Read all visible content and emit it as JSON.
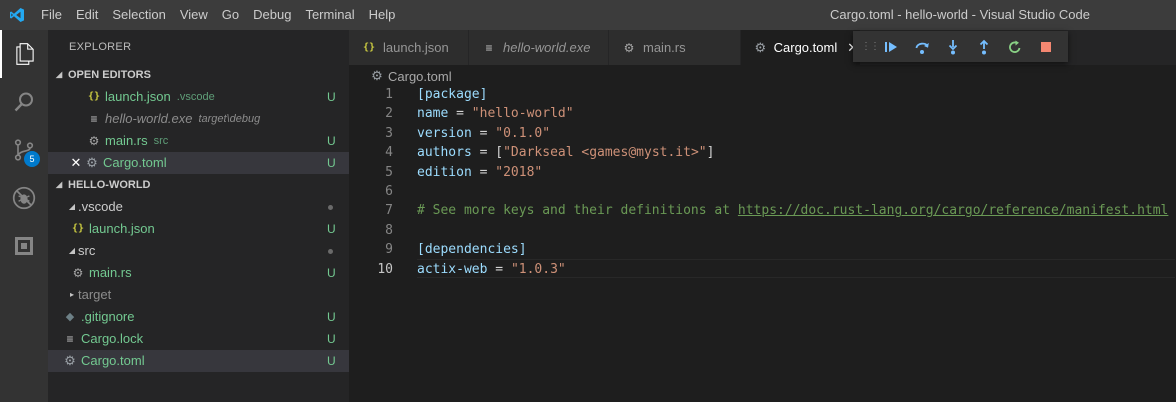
{
  "window": {
    "title": "Cargo.toml - hello-world - Visual Studio Code",
    "app_icon": "vscode-logo-icon",
    "accent": "#007acc"
  },
  "menu": [
    "File",
    "Edit",
    "Selection",
    "View",
    "Go",
    "Debug",
    "Terminal",
    "Help"
  ],
  "activity_bar": {
    "items": [
      "explorer-icon",
      "search-icon",
      "source-control-icon",
      "debug-icon",
      "extensions-icon"
    ],
    "scm_badge": "5"
  },
  "explorer": {
    "title": "EXPLORER",
    "open_editors": {
      "header": "OPEN EDITORS",
      "items": [
        {
          "name": "launch.json",
          "desc": ".vscode",
          "status": "U"
        },
        {
          "name": "hello-world.exe",
          "desc": "target\\debug",
          "status": ""
        },
        {
          "name": "main.rs",
          "desc": "src",
          "status": "U"
        },
        {
          "name": "Cargo.toml",
          "desc": "",
          "status": "U"
        }
      ]
    },
    "folder": {
      "header": "HELLO-WORLD",
      "items": [
        {
          "name": ".vscode",
          "status": ""
        },
        {
          "name": "launch.json",
          "status": "U"
        },
        {
          "name": "src",
          "status": ""
        },
        {
          "name": "main.rs",
          "status": "U"
        },
        {
          "name": "target",
          "status": ""
        },
        {
          "name": ".gitignore",
          "status": "U"
        },
        {
          "name": "Cargo.lock",
          "status": "U"
        },
        {
          "name": "Cargo.toml",
          "status": "U"
        }
      ]
    }
  },
  "tabs": [
    {
      "label": "launch.json",
      "active": false
    },
    {
      "label": "hello-world.exe",
      "active": false
    },
    {
      "label": "main.rs",
      "active": false
    },
    {
      "label": "Cargo.toml",
      "active": true
    }
  ],
  "debug_toolbar": [
    "continue-icon",
    "step-over-icon",
    "step-into-icon",
    "step-out-icon",
    "restart-icon",
    "stop-icon"
  ],
  "breadcrumb": "Cargo.toml",
  "editor": {
    "current_line": 10,
    "lines": [
      {
        "n": "1",
        "t": "[package]"
      },
      {
        "n": "2",
        "k": "name",
        "op": " = ",
        "v": "\"hello-world\""
      },
      {
        "n": "3",
        "k": "version",
        "op": " = ",
        "v": "\"0.1.0\""
      },
      {
        "n": "4",
        "k": "authors",
        "op": " = [",
        "v": "\"Darkseal <games@myst.it>\"",
        "tail": "]"
      },
      {
        "n": "5",
        "k": "edition",
        "op": " = ",
        "v": "\"2018\""
      },
      {
        "n": "6"
      },
      {
        "n": "7",
        "comment": "# See more keys and their definitions at ",
        "url": "https://doc.rust-lang.org/cargo/reference/manifest.html"
      },
      {
        "n": "8"
      },
      {
        "n": "9",
        "t": "[dependencies]"
      },
      {
        "n": "10",
        "k": "actix-web",
        "op": " = ",
        "v": "\"1.0.3\""
      }
    ]
  }
}
